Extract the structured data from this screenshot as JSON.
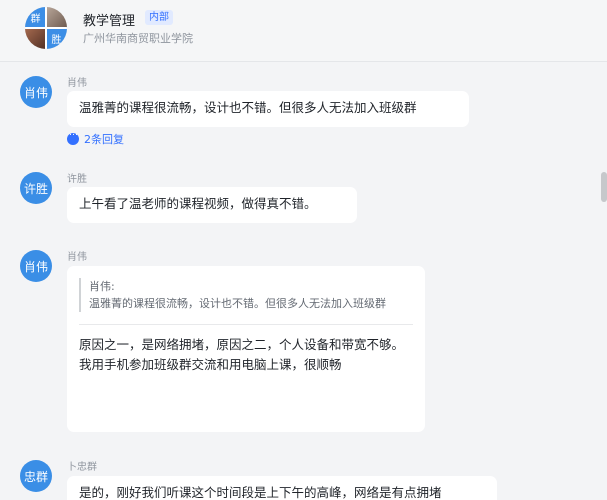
{
  "header": {
    "avatar_quadrants": [
      "群",
      "",
      "",
      "胜"
    ],
    "title": "教学管理",
    "badge": "内部",
    "subtitle": "广州华南商贸职业学院"
  },
  "messages": [
    {
      "avatar": "肖伟",
      "sender": "肖伟",
      "text": "温雅菁的课程很流畅，设计也不错。但很多人无法加入班级群",
      "reply": "2条回复"
    },
    {
      "avatar": "许胜",
      "sender": "许胜",
      "text": "上午看了温老师的课程视频，做得真不错。"
    },
    {
      "avatar": "肖伟",
      "sender": "肖伟",
      "quote_author": "肖伟:",
      "quote_text": "温雅菁的课程很流畅，设计也不错。但很多人无法加入班级群",
      "text": "原因之一，是网络拥堵，原因之二，个人设备和带宽不够。我用手机参加班级群交流和用电脑上课，很顺畅"
    },
    {
      "avatar": "忠群",
      "sender": "卜忠群",
      "text": "是的，刚好我们听课这个时间段是上下午的高峰，网络是有点拥堵"
    }
  ],
  "colors": {
    "accent": "#3370ff",
    "avatar": "#3a8ee6",
    "background": "#f3f4f6"
  }
}
